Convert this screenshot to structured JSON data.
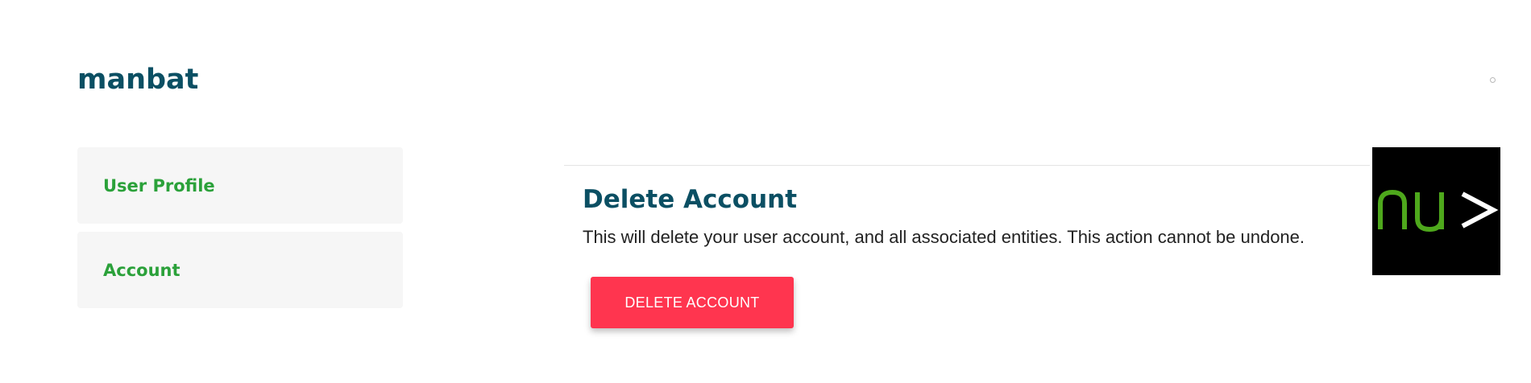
{
  "header": {
    "username": "manbat",
    "corner_icon": "info-circle-icon"
  },
  "sidebar": {
    "items": [
      {
        "label": "User Profile"
      },
      {
        "label": "Account"
      }
    ]
  },
  "main": {
    "section_title": "Delete Account",
    "description": "This will delete your user account, and all associated entities. This action cannot be undone.",
    "delete_button_label": "DELETE ACCOUNT"
  },
  "logo": {
    "icon": "nu-prompt-logo",
    "text": "nu>"
  },
  "colors": {
    "title": "#0b4f63",
    "nav_label": "#2ba13a",
    "danger": "#ff354f",
    "card_bg": "#f6f6f6",
    "logo_green": "#4ea81c"
  }
}
